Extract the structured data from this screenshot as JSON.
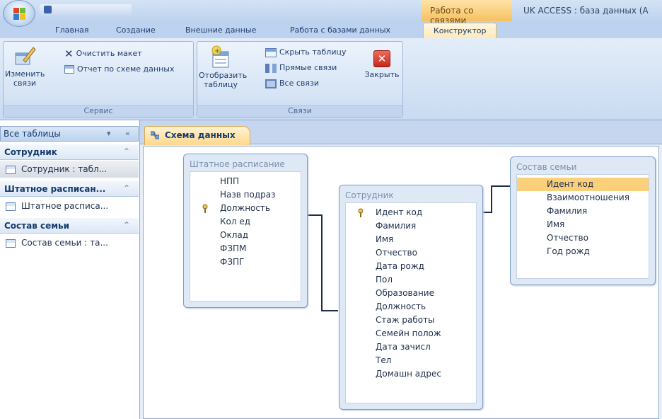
{
  "window": {
    "context_tab_title": "Работа со связями",
    "title": "UK ACCESS : база данных (A"
  },
  "ribbon_tabs": [
    {
      "label": "Главная"
    },
    {
      "label": "Создание"
    },
    {
      "label": "Внешние данные"
    },
    {
      "label": "Работа с базами данных"
    },
    {
      "label": "Конструктор",
      "active": true
    }
  ],
  "ribbon": {
    "service_group": {
      "label": "Сервис",
      "edit_links": "Изменить\nсвязи",
      "clear_layout": "Очистить макет",
      "report": "Отчет по схеме данных"
    },
    "links_group": {
      "label": "Связи",
      "show_table": "Отобразить\nтаблицу",
      "hide_table": "Скрыть таблицу",
      "direct_links": "Прямые связи",
      "all_links": "Все связи",
      "close": "Закрыть"
    }
  },
  "nav": {
    "header": "Все таблицы",
    "groups": [
      {
        "label": "Сотрудник",
        "item": "Сотрудник : табл..."
      },
      {
        "label": "Штатное расписан...",
        "item": "Штатное расписа..."
      },
      {
        "label": "Состав семьи",
        "item": "Состав семьи : та..."
      }
    ]
  },
  "document_tab": "Схема данных",
  "tables": [
    {
      "title": "Штатное расписание",
      "fields": [
        "НПП",
        "Назв подраз",
        "Должность",
        "Кол ед",
        "Оклад",
        "ФЗПМ",
        "ФЗПГ"
      ],
      "key_field": "Должность"
    },
    {
      "title": "Сотрудник",
      "fields": [
        "Идент код",
        "Фамилия",
        "Имя",
        "Отчество",
        "Дата рожд",
        "Пол",
        "Образование",
        "Должность",
        "Стаж работы",
        "Семейн полож",
        "Дата зачисл",
        "Тел",
        "Домашн адрес"
      ],
      "key_field": "Идент код"
    },
    {
      "title": "Состав семьи",
      "fields": [
        "Идент код",
        "Взаимоотношения",
        "Фамилия",
        "Имя",
        "Отчество",
        "Год рожд"
      ],
      "selected_field": "Идент код"
    }
  ],
  "colors": {
    "ribbon": "#c9dbf1",
    "active_tab": "#ffe9b6",
    "context_tab": "#f6c160",
    "highlight": "#fbd07a",
    "table_frame": "#7f9dc6"
  }
}
